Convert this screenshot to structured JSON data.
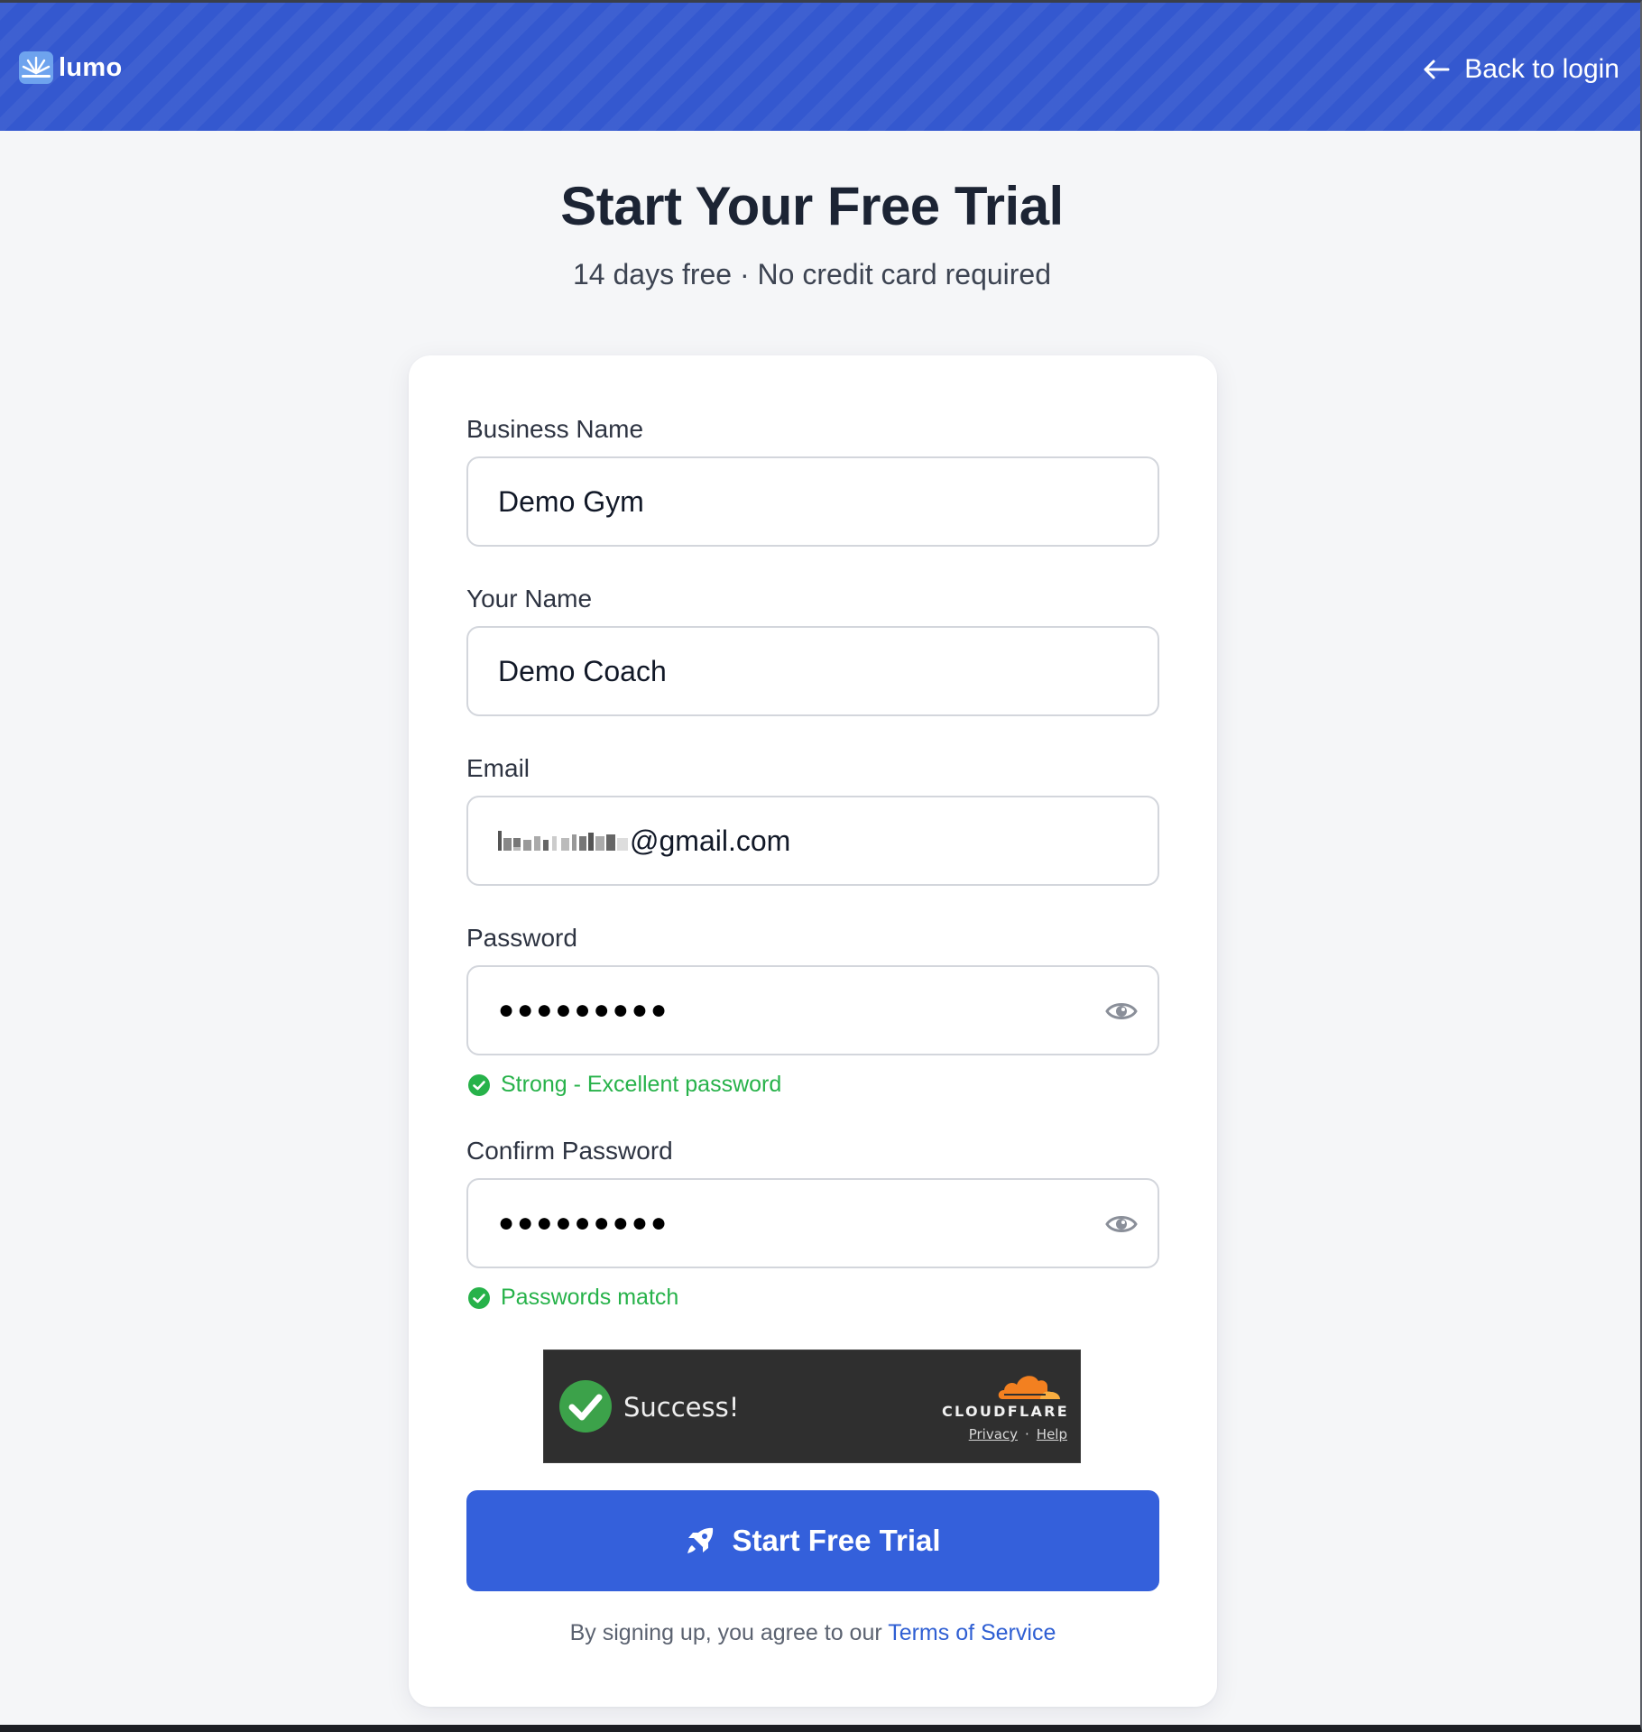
{
  "header": {
    "logo_text": "lumo",
    "back_link": "Back to login"
  },
  "page": {
    "title": "Start Your Free Trial",
    "subtitle": "14 days free · No credit card required"
  },
  "form": {
    "business_name": {
      "label": "Business Name",
      "value": "Demo Gym"
    },
    "your_name": {
      "label": "Your Name",
      "value": "Demo Coach"
    },
    "email": {
      "label": "Email",
      "value_redacted_prefix": "",
      "value_domain": "@gmail.com"
    },
    "password": {
      "label": "Password",
      "masked_value": "●●●●●●●●●",
      "strength_hint": "Strong - Excellent password"
    },
    "confirm_password": {
      "label": "Confirm Password",
      "masked_value": "●●●●●●●●●",
      "match_hint": "Passwords match"
    }
  },
  "captcha": {
    "status": "Success!",
    "brand": "CLOUDFLARE",
    "privacy_link": "Privacy",
    "separator": "·",
    "help_link": "Help"
  },
  "submit": {
    "label": "Start Free Trial"
  },
  "terms": {
    "prefix": "By signing up, you agree to our",
    "link": "Terms of Service"
  },
  "colors": {
    "header_blue": "#3458cf",
    "button_blue": "#3460db",
    "success_green": "#27b24a",
    "link_blue": "#2f5fd3",
    "cloudflare_orange": "#f38020"
  },
  "icons": {
    "logo": "sun-rays-icon",
    "back": "arrow-left-icon",
    "eye": "eye-icon",
    "check": "check-circle-icon",
    "button": "rocket-icon",
    "captcha_brand": "cloud-icon"
  }
}
